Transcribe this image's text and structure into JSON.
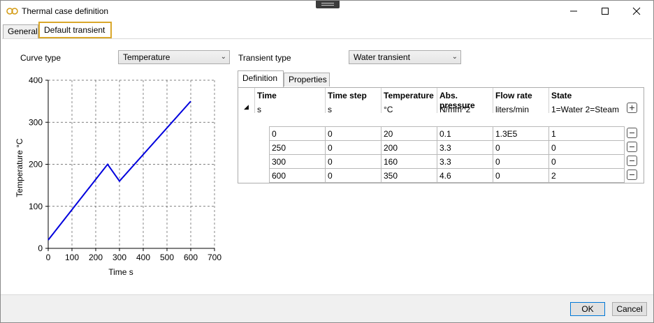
{
  "window": {
    "title": "Thermal case definition"
  },
  "tabs": {
    "general": "General",
    "transient": "Default transient"
  },
  "curve": {
    "label": "Curve type",
    "value": "Temperature"
  },
  "transient": {
    "label": "Transient type",
    "value": "Water transient"
  },
  "subtabs": {
    "definition": "Definition",
    "properties": "Properties"
  },
  "table": {
    "columns": [
      {
        "title": "Time",
        "unit": "s"
      },
      {
        "title": "Time step",
        "unit": "s"
      },
      {
        "title": "Temperature",
        "unit": "°C"
      },
      {
        "title": "Abs. pressure",
        "unit": "N/mm^2"
      },
      {
        "title": "Flow rate",
        "unit": "liters/min"
      },
      {
        "title": "State",
        "unit": "1=Water 2=Steam"
      }
    ],
    "rows": [
      [
        "0",
        "0",
        "20",
        "0.1",
        "1.3E5",
        "1"
      ],
      [
        "250",
        "0",
        "200",
        "3.3",
        "0",
        "0"
      ],
      [
        "300",
        "0",
        "160",
        "3.3",
        "0",
        "0"
      ],
      [
        "600",
        "0",
        "350",
        "4.6",
        "0",
        "2"
      ]
    ]
  },
  "buttons": {
    "ok": "OK",
    "cancel": "Cancel"
  },
  "chart_data": {
    "type": "line",
    "xlabel": "Time s",
    "ylabel": "Temperature  °C",
    "xlim": [
      0,
      700
    ],
    "ylim": [
      0,
      400
    ],
    "xticks": [
      "0",
      "100",
      "200",
      "300",
      "400",
      "500",
      "600",
      "700"
    ],
    "yticks": [
      "0",
      "100",
      "200",
      "300",
      "400"
    ],
    "grid": true,
    "line_color": "#0000dd",
    "series": [
      {
        "x": [
          0,
          250,
          300,
          600
        ],
        "y": [
          20,
          200,
          160,
          350
        ]
      }
    ]
  }
}
